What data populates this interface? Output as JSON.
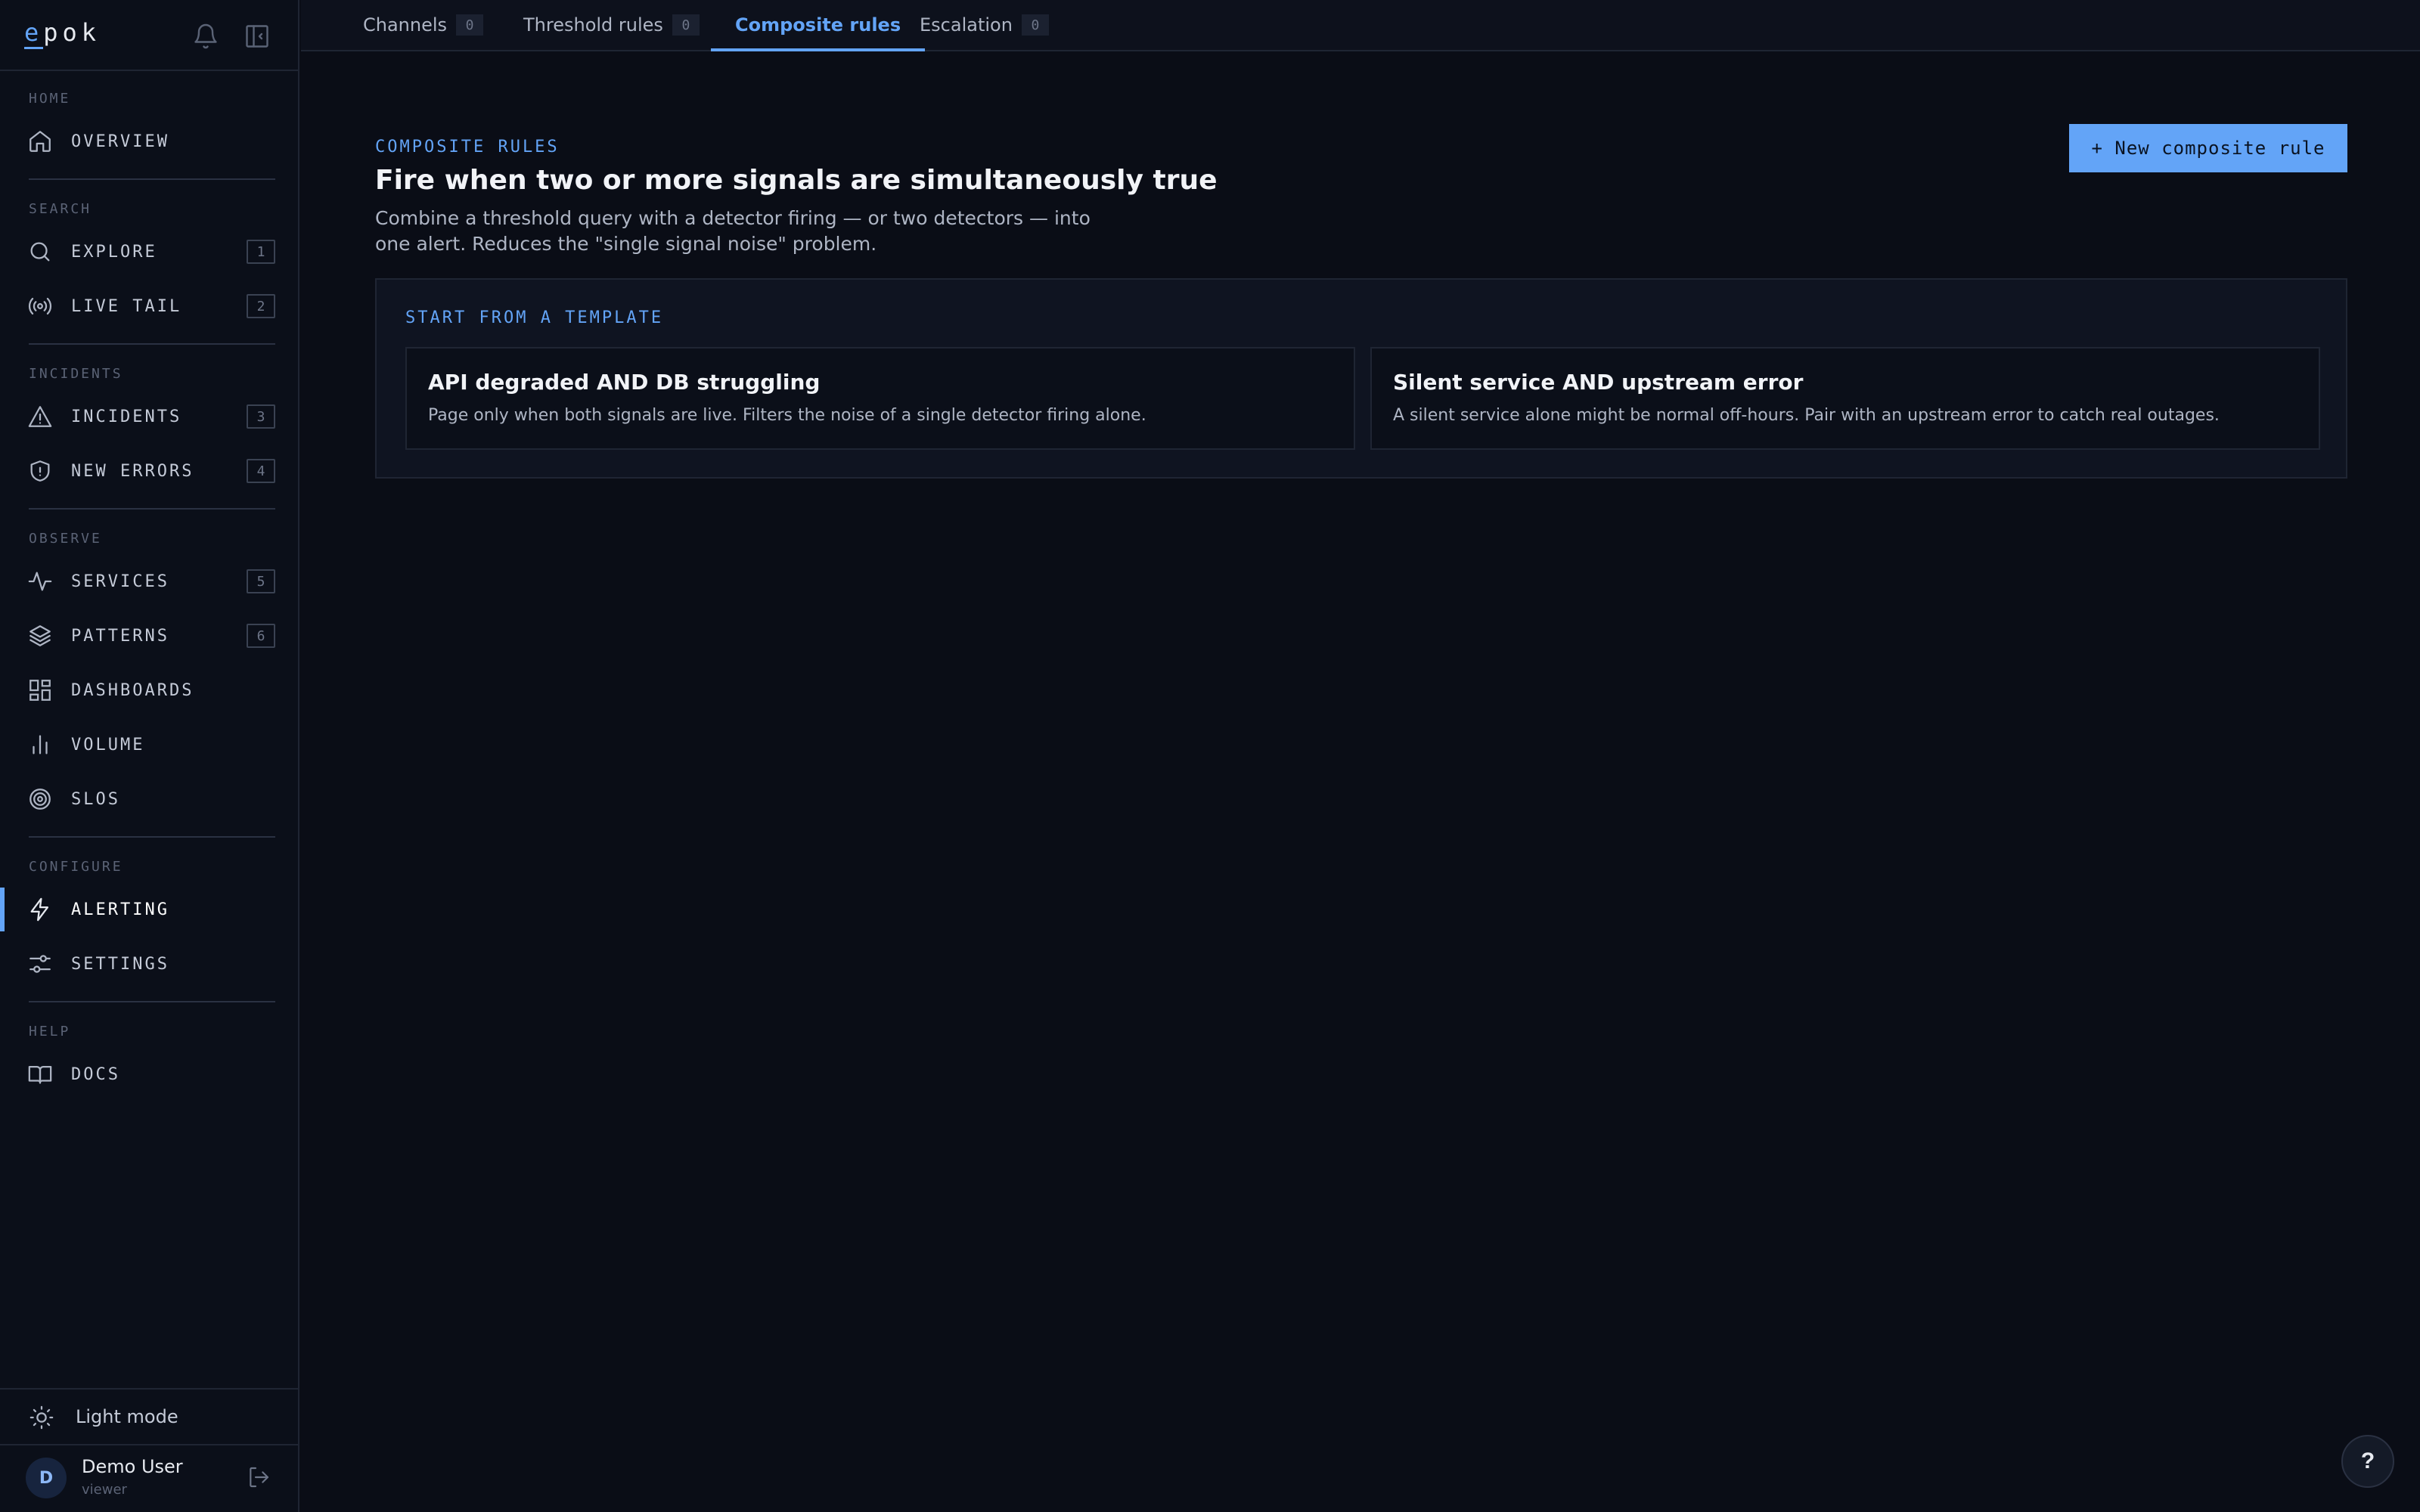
{
  "app": {
    "logo_first": "e",
    "logo_rest": "pok"
  },
  "sidebar": {
    "groups": [
      {
        "label": "HOME"
      },
      {
        "label": "SEARCH"
      },
      {
        "label": "INCIDENTS"
      },
      {
        "label": "OBSERVE"
      },
      {
        "label": "CONFIGURE"
      },
      {
        "label": "HELP"
      }
    ],
    "items": [
      {
        "label": "OVERVIEW",
        "icon": "home-icon"
      },
      {
        "label": "EXPLORE",
        "icon": "search-icon",
        "key": "1"
      },
      {
        "label": "LIVE TAIL",
        "icon": "broadcast-icon",
        "key": "2"
      },
      {
        "label": "INCIDENTS",
        "icon": "warning-icon",
        "key": "3"
      },
      {
        "label": "NEW ERRORS",
        "icon": "shield-icon",
        "key": "4"
      },
      {
        "label": "SERVICES",
        "icon": "activity-icon",
        "key": "5"
      },
      {
        "label": "PATTERNS",
        "icon": "layers-icon",
        "key": "6"
      },
      {
        "label": "DASHBOARDS",
        "icon": "grid-icon"
      },
      {
        "label": "VOLUME",
        "icon": "bar-chart-icon"
      },
      {
        "label": "SLOS",
        "icon": "target-icon"
      },
      {
        "label": "ALERTING",
        "icon": "bolt-icon",
        "active": true
      },
      {
        "label": "SETTINGS",
        "icon": "sliders-icon"
      },
      {
        "label": "DOCS",
        "icon": "book-icon"
      }
    ],
    "light_mode_label": "Light mode",
    "user": {
      "initial": "D",
      "name": "Demo User",
      "role": "viewer"
    }
  },
  "tabs": [
    {
      "label": "Channels",
      "count": "0"
    },
    {
      "label": "Threshold rules",
      "count": "0"
    },
    {
      "label": "Composite rules",
      "active": true
    },
    {
      "label": "Escalation",
      "count": "0"
    }
  ],
  "main": {
    "eyebrow": "COMPOSITE RULES",
    "title": "Fire when two or more signals are simultaneously true",
    "description": "Combine a threshold query with a detector firing — or two detectors — into one alert. Reduces the \"single signal noise\" problem.",
    "new_button": "+ New composite rule",
    "templates": {
      "title": "START FROM A TEMPLATE",
      "cards": [
        {
          "title": "API degraded AND DB struggling",
          "description": "Page only when both signals are live. Filters the noise of a single detector firing alone."
        },
        {
          "title": "Silent service AND upstream error",
          "description": "A silent service alone might be normal off-hours. Pair with an upstream error to catch real outages."
        }
      ]
    }
  },
  "help": {
    "label": "?"
  },
  "colors": {
    "accent": "#63a4f7",
    "background": "#0a0d16",
    "sidebar": "#0b0f19"
  }
}
